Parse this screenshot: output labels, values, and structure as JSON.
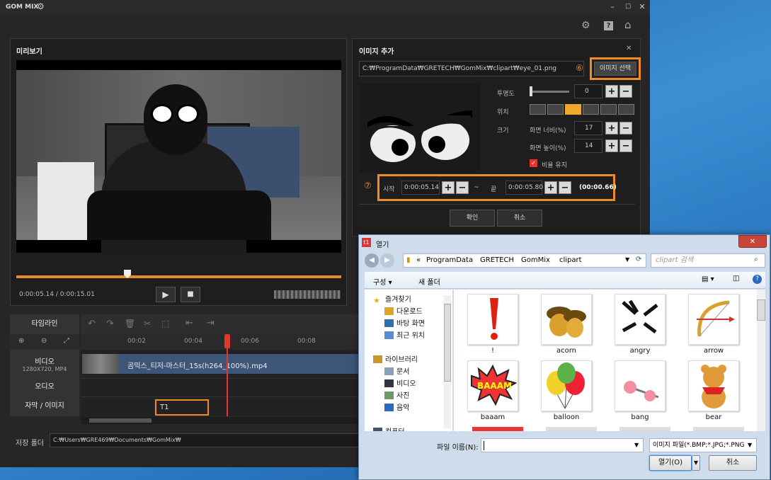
{
  "app": {
    "logo": "GOM MIX",
    "top_icons": [
      "gear-icon",
      "help-icon",
      "home-icon"
    ]
  },
  "preview": {
    "title": "미리보기",
    "time_current": "0:00:05.14",
    "time_total": "0:00:15.01",
    "progress": 0.37
  },
  "image_panel": {
    "title": "이미지 추가",
    "path": "C:₩ProgramData₩GRETECH₩GomMix₩clipart₩eye_01.png",
    "marker6": "⑥",
    "select_button": "이미지 선택",
    "opacity_label": "투명도",
    "opacity_value": "0",
    "position_label": "위치",
    "position_selected_index": 2,
    "size_label": "크기",
    "width_label": "화면 너비(%)",
    "width_value": "17",
    "height_label": "화면 높이(%)",
    "height_value": "14",
    "keep_ratio_label": "비율 유지",
    "keep_ratio": true,
    "marker7": "⑦",
    "start_label": "시작",
    "start_value": "0:00:05.14",
    "tilde": "~",
    "end_label": "끝",
    "end_value": "0:00:05.80",
    "duration": "(00:00.66)",
    "confirm": "확인",
    "cancel": "취소"
  },
  "timeline": {
    "tab_label": "타임라인",
    "ruler": [
      "00:02",
      "00:04",
      "00:06",
      "00:08"
    ],
    "tracks": [
      {
        "name": "비디오",
        "sub": "1280X720, MP4",
        "clip": "곰믹스_티저-마스터_15s(h264_100%).mp4"
      },
      {
        "name": "오디오"
      },
      {
        "name": "자막 / 이미지",
        "clip": "T1"
      }
    ]
  },
  "save": {
    "label": "저장 폴더",
    "path": "C:₩Users₩GRE469₩Documents₩GomMix₩"
  },
  "dialog": {
    "title": "열기",
    "breadcrumb": [
      "«",
      "ProgramData",
      "GRETECH",
      "GomMix",
      "clipart"
    ],
    "search_placeholder": "clipart 검색",
    "organize": "구성 ▾",
    "new_folder": "새 폴더",
    "nav": [
      {
        "label": "즐겨찾기",
        "icon": "star-icon",
        "indent": 0
      },
      {
        "label": "다운로드",
        "icon": "download-folder-icon",
        "indent": 1
      },
      {
        "label": "바탕 화면",
        "icon": "desktop-icon",
        "indent": 1
      },
      {
        "label": "최근 위치",
        "icon": "recent-icon",
        "indent": 1
      },
      {
        "label": "",
        "icon": "",
        "indent": 0
      },
      {
        "label": "라이브러리",
        "icon": "library-icon",
        "indent": 0
      },
      {
        "label": "문서",
        "icon": "documents-icon",
        "indent": 1
      },
      {
        "label": "비디오",
        "icon": "video-icon",
        "indent": 1
      },
      {
        "label": "사진",
        "icon": "pictures-icon",
        "indent": 1
      },
      {
        "label": "음악",
        "icon": "music-icon",
        "indent": 1
      },
      {
        "label": "",
        "icon": "",
        "indent": 0
      },
      {
        "label": "컴퓨터",
        "icon": "computer-icon",
        "indent": 0
      }
    ],
    "files": [
      "!",
      "acorn",
      "angry",
      "arrow",
      "baaam",
      "balloon",
      "bang",
      "bear"
    ],
    "filename_label": "파일 이름(N):",
    "filename_value": "",
    "filetype": "이미지 파일(*.BMP;*.JPG;*.PNG",
    "open": "열기(O)",
    "cancel": "취소"
  }
}
